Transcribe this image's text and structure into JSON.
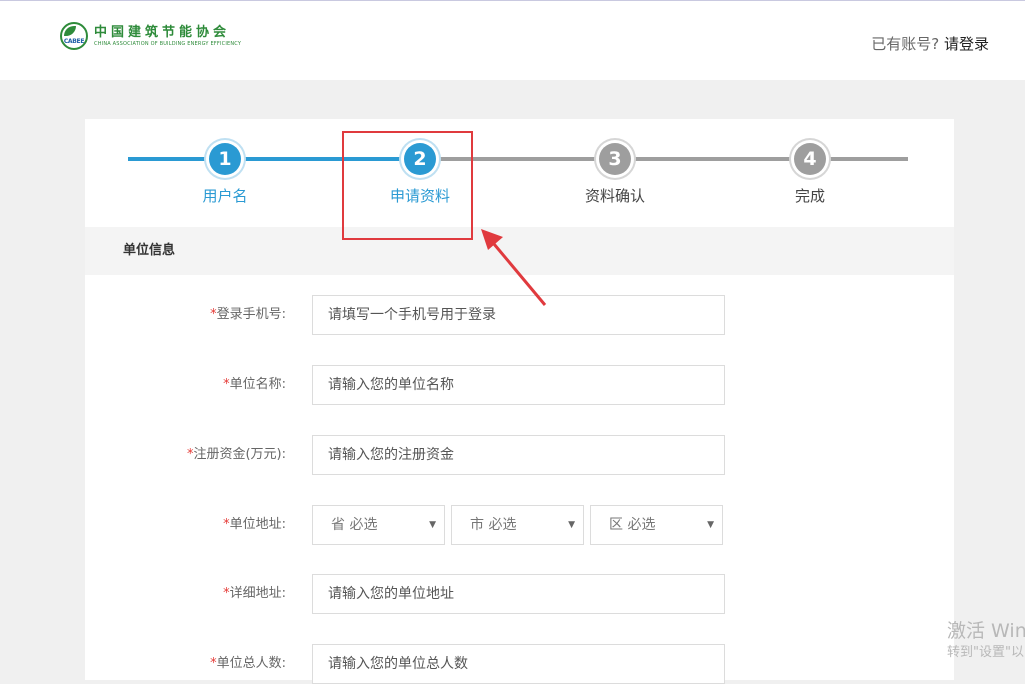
{
  "header": {
    "logo_abbr": "CABEE",
    "logo_cn": "中国建筑节能协会",
    "logo_en": "CHINA ASSOCIATION OF BUILDING ENERGY EFFICIENCY",
    "login_hint": "已有账号?",
    "login_link": "请登录"
  },
  "steps": [
    {
      "number": "1",
      "label": "用户名",
      "state": "done"
    },
    {
      "number": "2",
      "label": "申请资料",
      "state": "active"
    },
    {
      "number": "3",
      "label": "资料确认",
      "state": "pending"
    },
    {
      "number": "4",
      "label": "完成",
      "state": "pending"
    }
  ],
  "colors": {
    "active": "#2a9ad3",
    "pending": "#9e9e9e",
    "required_mark": "#e53935",
    "annotation": "#e03a3e"
  },
  "section_title": "单位信息",
  "form": {
    "phone": {
      "label": "登录手机号:",
      "required_mark": "*",
      "placeholder": "请填写一个手机号用于登录"
    },
    "org_name": {
      "label": "单位名称:",
      "required_mark": "*",
      "placeholder": "请输入您的单位名称"
    },
    "capital": {
      "label": "注册资金(万元):",
      "required_mark": "*",
      "placeholder": "请输入您的注册资金"
    },
    "address": {
      "label": "单位地址:",
      "required_mark": "*",
      "province": "省 必选",
      "city": "市 必选",
      "district": "区 必选"
    },
    "detail_address": {
      "label": "详细地址:",
      "required_mark": "*",
      "placeholder": "请输入您的单位地址"
    },
    "headcount": {
      "label": "单位总人数:",
      "required_mark": "*",
      "placeholder": "请输入您的单位总人数"
    }
  },
  "caret_glyph": "▼",
  "watermark": {
    "line1": "激活 Win",
    "line2": "转到\"设置\"以"
  }
}
